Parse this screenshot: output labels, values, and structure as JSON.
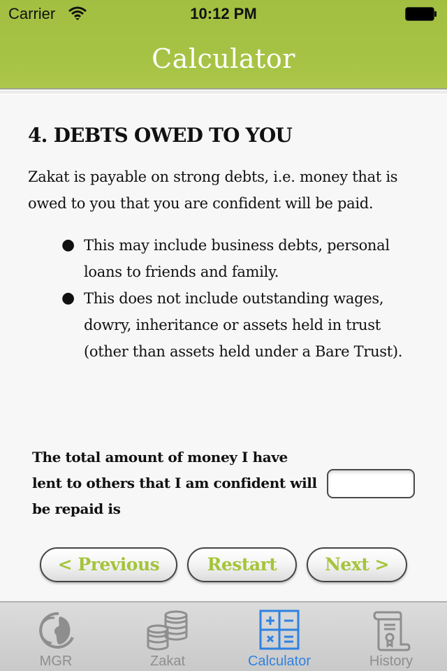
{
  "status_bar": {
    "carrier": "Carrier",
    "time": "10:12 PM",
    "wifi_icon": "wifi-icon",
    "battery_icon": "battery-full-icon"
  },
  "nav": {
    "title": "Calculator",
    "accent_color": "#a6c345"
  },
  "section": {
    "heading": "4. DEBTS OWED TO YOU",
    "intro": "Zakat is payable on strong debts, i.e. money that is owed to you that you are confident will be paid.",
    "bullets": [
      "This may include business debts, personal loans to friends and family.",
      "This does not include outstanding wages, dowry, inheritance or assets held in trust (other than assets held under a Bare Trust)."
    ],
    "bullet_glyph": "●"
  },
  "question": {
    "label": "The total amount of money I have lent to others that I am confident will be repaid is",
    "input_value": "",
    "input_placeholder": ""
  },
  "buttons": {
    "previous": "< Previous",
    "restart": "Restart",
    "next": "Next >",
    "text_color": "#a5c43c"
  },
  "tabbar": {
    "active_color": "#2f82e0",
    "inactive_color": "#8e8e8e",
    "items": [
      {
        "label": "MGR",
        "icon": "globe-icon",
        "active": false
      },
      {
        "label": "Zakat",
        "icon": "coins-icon",
        "active": false
      },
      {
        "label": "Calculator",
        "icon": "calculator-icon",
        "active": true
      },
      {
        "label": "History",
        "icon": "scroll-certificate-icon",
        "active": false
      }
    ]
  }
}
